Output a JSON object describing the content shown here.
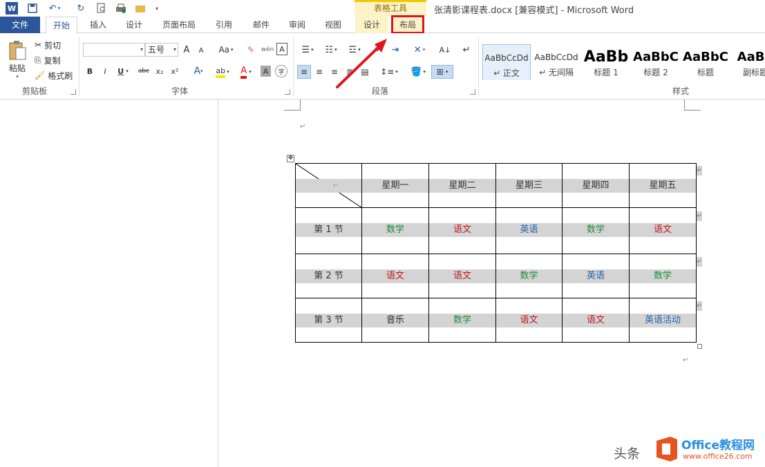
{
  "window": {
    "contextual_group": "表格工具",
    "document_title": "张清影课程表.docx [兼容模式] - Microsoft Word"
  },
  "tabs": [
    "文件",
    "开始",
    "插入",
    "设计",
    "页面布局",
    "引用",
    "邮件",
    "审阅",
    "视图",
    "设计",
    "布局"
  ],
  "ribbon": {
    "clipboard": {
      "paste": "粘贴",
      "cut": "剪切",
      "copy": "复制",
      "format_painter": "格式刷",
      "label": "剪贴板"
    },
    "font": {
      "font_name": "",
      "font_size": "五号",
      "grow": "A",
      "shrink": "A",
      "change_case": "Aa",
      "bold": "B",
      "italic": "I",
      "underline": "U",
      "strike": "abc",
      "subscript": "x₂",
      "superscript": "x²",
      "label": "字体"
    },
    "paragraph": {
      "label": "段落"
    },
    "styles": {
      "items": [
        {
          "sample": "AaBbCcDd",
          "name": "↵ 正文"
        },
        {
          "sample": "AaBbCcDd",
          "name": "↵ 无间隔"
        },
        {
          "sample": "AaBb",
          "name": "标题 1"
        },
        {
          "sample": "AaBbC",
          "name": "标题 2"
        },
        {
          "sample": "AaBbC",
          "name": "标题"
        },
        {
          "sample": "AaBb",
          "name": "副标题"
        }
      ],
      "label": "样式"
    }
  },
  "schedule": {
    "header": [
      "",
      "星期一",
      "星期二",
      "星期三",
      "星期四",
      "星期五"
    ],
    "rows": [
      {
        "label": "第 1 节",
        "cells": [
          {
            "text": "数学",
            "color": "#1e8a3a"
          },
          {
            "text": "语文",
            "color": "#c0151b"
          },
          {
            "text": "英语",
            "color": "#1f5fae"
          },
          {
            "text": "数学",
            "color": "#1e8a3a"
          },
          {
            "text": "语文",
            "color": "#c0151b"
          }
        ]
      },
      {
        "label": "第 2 节",
        "cells": [
          {
            "text": "语文",
            "color": "#c0151b"
          },
          {
            "text": "语文",
            "color": "#c0151b"
          },
          {
            "text": "数学",
            "color": "#1e8a3a"
          },
          {
            "text": "英语",
            "color": "#1f5fae"
          },
          {
            "text": "数学",
            "color": "#1e8a3a"
          }
        ]
      },
      {
        "label": "第 3 节",
        "cells": [
          {
            "text": "音乐",
            "color": "#222222"
          },
          {
            "text": "数学",
            "color": "#1e8a3a"
          },
          {
            "text": "语文",
            "color": "#c0151b"
          },
          {
            "text": "语文",
            "color": "#c0151b"
          },
          {
            "text": "英语活动",
            "color": "#1f5fae"
          }
        ]
      }
    ]
  },
  "watermark": {
    "prefix": "头条",
    "brand": "Office教程网",
    "url": "www.office26.com"
  },
  "colors": {
    "file_tab": "#2b579a",
    "highlight": "#e3131a",
    "contextual": "#fdf3c8"
  }
}
